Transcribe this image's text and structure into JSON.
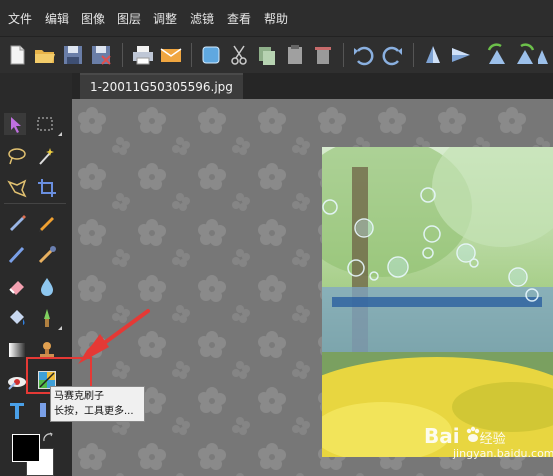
{
  "menu": {
    "items": [
      "文件",
      "编辑",
      "图像",
      "图层",
      "调整",
      "滤镜",
      "查看",
      "帮助"
    ]
  },
  "toolbar": {
    "buttons": [
      "new-file",
      "open-folder",
      "save",
      "save-as",
      "print",
      "email",
      "window",
      "cut",
      "copy",
      "paste",
      "delete",
      "undo",
      "redo",
      "flip-vertical",
      "flip-horizontal",
      "rotate-left",
      "rotate-right",
      "more"
    ]
  },
  "document": {
    "tab_title": "1-20011G50305596.jpg"
  },
  "tools": {
    "names": [
      "select-arrow",
      "marquee",
      "lasso",
      "magic-wand",
      "polygon-lasso",
      "crop",
      "pen",
      "pencil",
      "brush",
      "color-picker",
      "eraser",
      "drop",
      "fill-bucket",
      "sharpen",
      "gradient",
      "stamp",
      "red-eye",
      "photo-brush",
      "text",
      "shape"
    ]
  },
  "tooltip": {
    "line1": "马赛克刷子",
    "line2": "长按，工具更多..."
  },
  "colors": {
    "foreground": "#000000",
    "background": "#ffffff",
    "highlight": "#e53935"
  },
  "watermark": {
    "brand": "Bai",
    "brand2": "经验",
    "url": "jingyan.baidu.com"
  }
}
